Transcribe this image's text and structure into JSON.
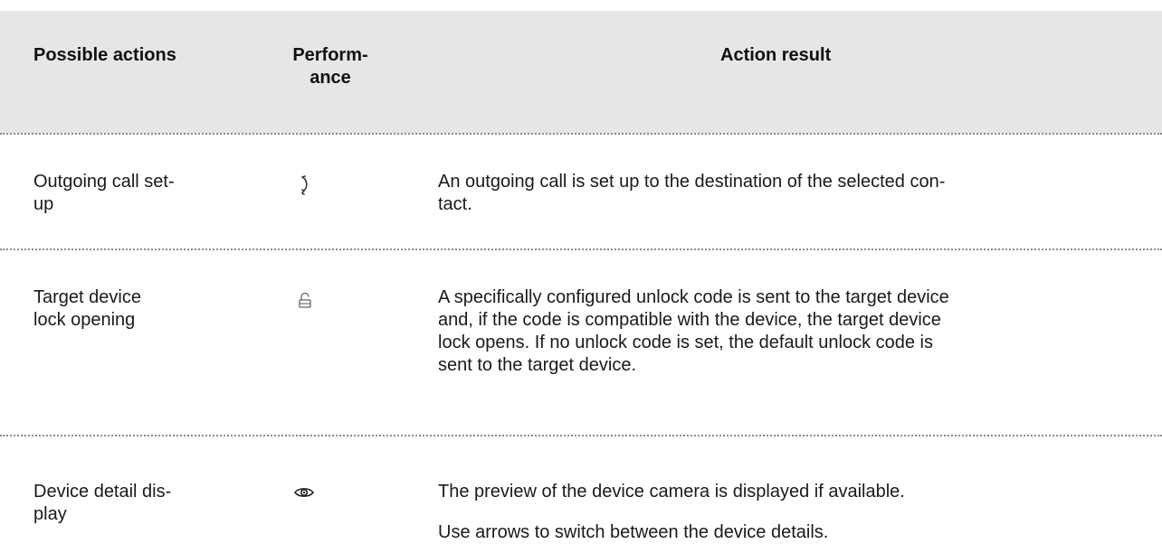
{
  "headers": {
    "actions": [
      "Possible actions"
    ],
    "performance": [
      "Perform-",
      "ance"
    ],
    "result": [
      "Action result"
    ]
  },
  "rows": [
    {
      "action": [
        "Outgoing call set-",
        "up"
      ],
      "icon": "phone-handset-icon",
      "result": [
        [
          "An outgoing call is set up to the destination of the selected con-",
          "tact."
        ]
      ]
    },
    {
      "action": [
        "Target device",
        "lock opening"
      ],
      "icon": "unlock-icon",
      "result": [
        [
          "A specifically configured unlock code is sent to the target device",
          "and, if the code is compatible with the device, the target device",
          "lock opens. If no unlock code is set, the default unlock code is",
          "sent to the target device."
        ]
      ]
    },
    {
      "action": [
        "Device detail dis-",
        "play"
      ],
      "icon": "eye-icon",
      "result": [
        [
          "The preview of the device camera is displayed if available."
        ],
        [
          "Use arrows to switch between the device details."
        ]
      ]
    }
  ],
  "colors": {
    "header_bg": "#e6e6e6",
    "divider": "#8c8c8c",
    "text": "#1a1a1a"
  }
}
